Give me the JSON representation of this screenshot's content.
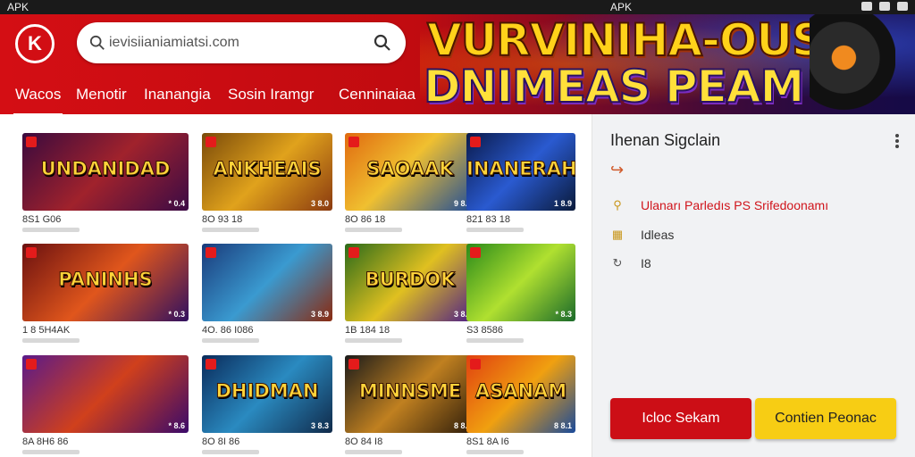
{
  "status_bar": {
    "left_text": "APK",
    "center_text": "APK"
  },
  "header": {
    "logo_letter": "K",
    "search_placeholder": "ievisiianiamiatsi.com",
    "tabs": [
      "Wacos",
      "Menotir",
      "Inanangia",
      "Sosin Iramgr",
      "Cenninaiaa"
    ],
    "active_tab_index": 0
  },
  "banner": {
    "line1": "VURVINIHA-OUSA",
    "line2": "DNIMEAS PEAM"
  },
  "games": [
    {
      "title": "UNDANIDAD",
      "meta": "8S1 G06",
      "score": "* 0.4",
      "bg": "linear-gradient(135deg,#3a0a3e,#a0222c 50%,#3b0b45)"
    },
    {
      "title": "ANKHEAIS",
      "meta": "8O 93 18",
      "score": "3 8.0",
      "bg": "linear-gradient(135deg,#7a4a0a,#e0a21c 50%,#8a3a10)"
    },
    {
      "title": "SAOAAK",
      "meta": "8O 86 18",
      "score": "9 8.8",
      "bg": "linear-gradient(135deg,#e06a10,#f0c030 45%,#1a4a9a)"
    },
    {
      "title": "INANERAH",
      "meta": "821 83 18",
      "score": "1 8.9",
      "bg": "linear-gradient(135deg,#0a1a4a,#2a5ad0 50%,#0a1a3a)"
    },
    {
      "title": "PANINHS",
      "meta": "1 8 5H4AK",
      "score": "* 0.3",
      "bg": "linear-gradient(135deg,#6a1010,#e0561c 50%,#301060)"
    },
    {
      "title": "",
      "meta": "4O. 86 I086",
      "score": "3 8.9",
      "bg": "linear-gradient(135deg,#1a3a7a,#3a9ad0 50%,#8a2a10)"
    },
    {
      "title": "BURDOK",
      "meta": "1B 184 18",
      "score": "3 8.3",
      "bg": "linear-gradient(135deg,#2a6a1a,#e0c020 50%,#4a1a8a)"
    },
    {
      "title": "",
      "meta": "S3 8586",
      "score": "* 8.3",
      "bg": "linear-gradient(135deg,#2a8a1a,#b0e030 50%,#1a6a2a)"
    },
    {
      "title": "",
      "meta": "8A 8H6 86",
      "score": "* 8.6",
      "bg": "linear-gradient(135deg,#5a1a8a,#d0401c 50%,#3a0a6a)"
    },
    {
      "title": "DHIDMAN",
      "meta": "8O 8I 86",
      "score": "3 8.3",
      "bg": "linear-gradient(135deg,#0a2a5a,#2a8ac0 50%,#102a4a)"
    },
    {
      "title": "MINNSME",
      "meta": "8O 84 I8",
      "score": "8 8.9",
      "bg": "linear-gradient(135deg,#1a1a1a,#c08020 50%,#2a1a0a)"
    },
    {
      "title": "ASANAM",
      "meta": "8S1 8A I6",
      "score": "8 8.1",
      "bg": "linear-gradient(135deg,#e04010,#f0a010 50%,#1a4a9a)"
    }
  ],
  "panel": {
    "heading": "Ihenan Sigclain",
    "rows": [
      "Ulanarı Parledıs PS Srifedoonamı",
      "Idleas",
      "I8"
    ],
    "primary_button": "Icloc Sekam",
    "secondary_button": "Contien Peonac"
  },
  "colors": {
    "brand_red": "#cc0e16",
    "accent_yellow": "#f7cd14"
  }
}
